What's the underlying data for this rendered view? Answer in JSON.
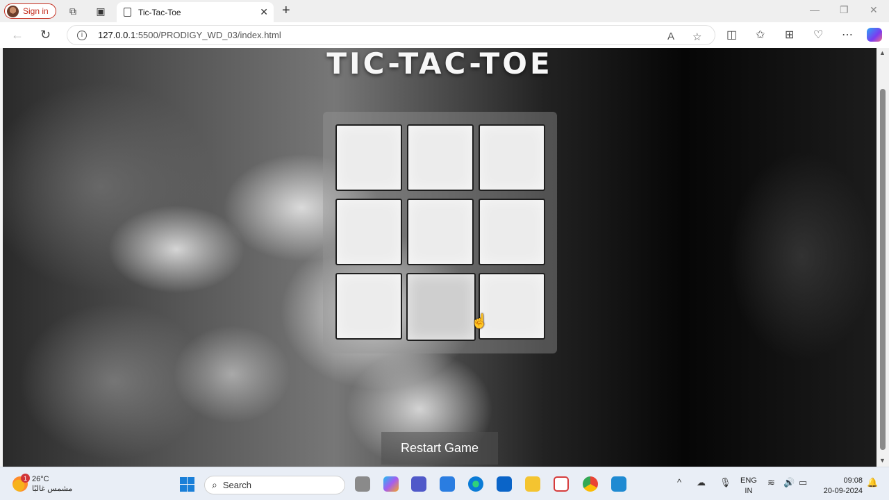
{
  "browser": {
    "profile_label": "Sign in",
    "tab_title": "Tic-Tac-Toe",
    "tab_close": "✕",
    "new_tab": "+",
    "url_host": "127.0.0.1",
    "url_rest": ":5500/PRODIGY_WD_03/index.html"
  },
  "page": {
    "title": "TIC-TAC-TOE",
    "cells": [
      "",
      "",
      "",
      "",
      "",
      "",
      "",
      "",
      ""
    ],
    "restart_label": "Restart Game"
  },
  "taskbar": {
    "weather_temp": "26°C",
    "weather_desc": "مشمس غالبًا",
    "weather_badge": "1",
    "search_label": "Search",
    "lang_line1": "ENG",
    "lang_line2": "IN",
    "time": "09:08",
    "date": "20-09-2024"
  }
}
